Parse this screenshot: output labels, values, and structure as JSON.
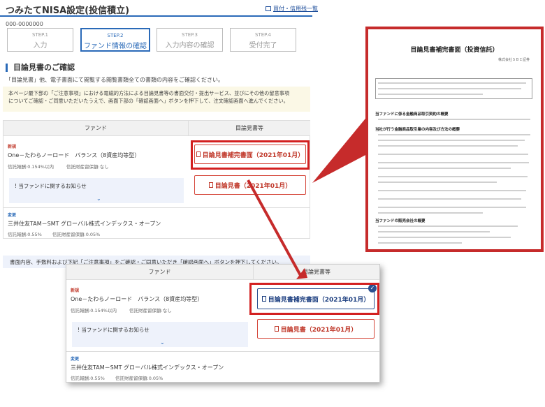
{
  "header": {
    "title": "つみたてNISA設定(投信積立)",
    "link": "買付・信用残一覧",
    "account": "000-0000000"
  },
  "steps": [
    {
      "num": "STEP.1",
      "label": "入力"
    },
    {
      "num": "STEP.2",
      "label": "ファンド情報の確認"
    },
    {
      "num": "STEP.3",
      "label": "入力内容の確認"
    },
    {
      "num": "STEP.4",
      "label": "受付完了"
    }
  ],
  "section": {
    "heading": "目論見書のご確認",
    "description": "「目論見書」他、電子書面にて閲覧する閲覧書類全ての書類の内容をご確認ください。",
    "notice_line1": "本ページ最下部の「ご注意事項」における電磁的方法による目論見書等の書面交付・提出サービス、並びにその他の留意事項",
    "notice_line2": "についてご確認・ご同意いただいたうえで、画面下部の「確認画面へ」ボタンを押下して、注文確認画面へ進んでください。"
  },
  "table": {
    "col_fund": "ファンド",
    "col_docs": "目論見書等",
    "rows": [
      {
        "tag": "新規",
        "fund_name": "One－たわらノーロード　バランス（8資産均等型）",
        "fee": "信託報酬:0.154%以内",
        "reserve": "信託財産留保額:なし",
        "notice": "当ファンドに関するお知らせ",
        "doc1": "目論見書補完書面（2021年01月）",
        "doc2": "目論見書（2021年01月）"
      },
      {
        "tag": "変更",
        "fund_name": "三井住友TAM－SMT グローバル株式インデックス・オープン",
        "fee": "信託報酬:0.55%",
        "reserve": "信託財産留保額:0.05%"
      }
    ]
  },
  "notice2": "書面内容、手数料および下記「ご注意事項」をご確認・ご同意いただき「確認画面へ」ボタンを押下してください。",
  "document": {
    "title": "目論見書補完書面（投資信託）",
    "subtitle": "株式会社ＳＢＩ証券",
    "sections": [
      "当ファンドに係る金融商品取引契約の概要",
      "当社が行う金融商品取引業の内容及び方法の概要",
      "当ファンドの販売会社の概要"
    ]
  },
  "colors": {
    "accent": "#2a6ab8",
    "highlight": "#d32020",
    "doc_btn": "#c0392b"
  }
}
